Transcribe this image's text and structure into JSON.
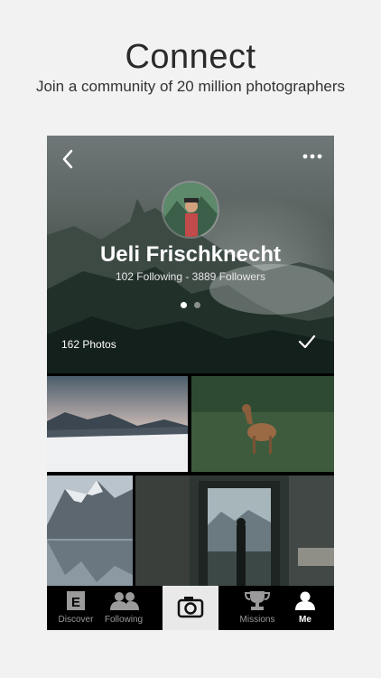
{
  "promo": {
    "title": "Connect",
    "subtitle": "Join a community of 20 million photographers"
  },
  "profile": {
    "name": "Ueli Frischknecht",
    "stats": "102 Following - 3889 Followers",
    "photo_count": "162 Photos",
    "pager": {
      "pages": 2,
      "current": 1
    }
  },
  "icons": {
    "back": "chevron-left-icon",
    "more": "more-dots-icon",
    "follow_status": "checkmark-icon",
    "camera": "camera-icon"
  },
  "photos": [
    "snowy-landscape",
    "deer-in-grass",
    "mountain-lake",
    "person-at-window"
  ],
  "tabbar": {
    "tabs": [
      {
        "label": "Discover",
        "icon": "discover-icon",
        "selected": false
      },
      {
        "label": "Following",
        "icon": "following-icon",
        "selected": false
      },
      {
        "label": "Missions",
        "icon": "trophy-icon",
        "selected": false
      },
      {
        "label": "Me",
        "icon": "person-icon",
        "selected": true
      }
    ]
  },
  "colors": {
    "background": "#f2f2f2",
    "tabbar": "#000000",
    "camera_tab": "#e9e9e9",
    "active_tab": "#ffffff",
    "inactive_tab": "#9a9a9a"
  }
}
